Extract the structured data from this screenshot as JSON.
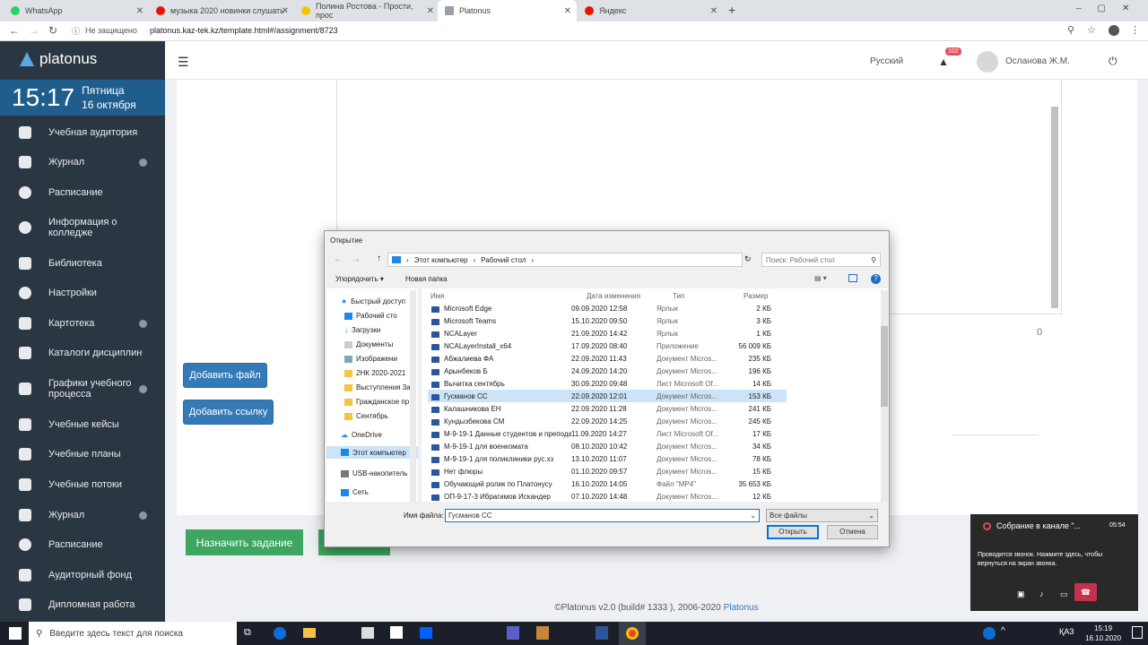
{
  "browser": {
    "tabs": [
      {
        "label": "WhatsApp",
        "color": "#25d366"
      },
      {
        "label": "музыка 2020 новинки слушать",
        "color": "#e61400"
      },
      {
        "label": "Полина Ростова - Прости, прос",
        "color": "#f5c400"
      },
      {
        "label": "Platonus",
        "color": "#9aa0a6"
      },
      {
        "label": "Яндекс",
        "color": "#e61400"
      }
    ],
    "security": "Не защищено",
    "url": "platonus.kaz-tek.kz/template.html#/assignment/8723"
  },
  "sidebar": {
    "logo": "platonus",
    "time": "15:17",
    "weekday": "Пятница",
    "date": "16 октября",
    "items": [
      "Учебная аудитория",
      "Журнал",
      "Расписание",
      "Информация о колледже",
      "Библиотека",
      "Настройки",
      "Картотека",
      "Каталоги дисциплин",
      "Графики учебного процесса",
      "Учебные кейсы",
      "Учебные планы",
      "Учебные потоки",
      "Журнал",
      "Расписание",
      "Аудиторный фонд",
      "Дипломная работа"
    ]
  },
  "header": {
    "language": "Русский",
    "notifications": "102",
    "user": "Осланова Ж.М."
  },
  "content": {
    "counter": "0",
    "add_file": "Добавить файл",
    "add_link": "Добавить ссылку",
    "assign": "Назначить задание"
  },
  "footer": {
    "text": "©Platonus v2.0 (build# 1333 ), 2006-2020 ",
    "link": "Platonus"
  },
  "dialog": {
    "title": "Открытие",
    "path": [
      "Этот компьютер",
      "Рабочий стол"
    ],
    "search_placeholder": "Поиск: Рабочий стол",
    "organize": "Упорядочить ▾",
    "new_folder": "Новая папка",
    "columns": {
      "name": "Имя",
      "date": "Дата изменения",
      "type": "Тип",
      "size": "Размер"
    },
    "tree": [
      "Быстрый доступ",
      "Рабочий сто",
      "Загрузки",
      "Документы",
      "Изображени",
      "2НК 2020-2021",
      "Выступления 3а",
      "Гражданское пр",
      "Сентябрь",
      "OneDrive",
      "Этот компьютер",
      "USB-накопитель",
      "Сеть"
    ],
    "files": [
      [
        "Microsoft Edge",
        "09.09.2020 12:58",
        "Ярлык",
        "2 КБ"
      ],
      [
        "Microsoft Teams",
        "15.10.2020 09:50",
        "Ярлык",
        "3 КБ"
      ],
      [
        "NCALayer",
        "21.09.2020 14:42",
        "Ярлык",
        "1 КБ"
      ],
      [
        "NCALayerInstall_x64",
        "17.09.2020 08:40",
        "Приложение",
        "56 009 КБ"
      ],
      [
        "Абжалиева ФА",
        "22.09.2020 11:43",
        "Документ Micros...",
        "235 КБ"
      ],
      [
        "Арынбеков Б",
        "24.09.2020 14:20",
        "Документ Micros...",
        "196 КБ"
      ],
      [
        "Вычитка сентябрь",
        "30.09.2020 09:48",
        "Лист Microsoft Of...",
        "14 КБ"
      ],
      [
        "Гусманов СС",
        "22.09.2020 12:01",
        "Документ Micros...",
        "153 КБ"
      ],
      [
        "Калашникова ЕН",
        "22.09.2020 11:28",
        "Документ Micros...",
        "241 КБ"
      ],
      [
        "Кундызбекова СМ",
        "22.09.2020 14:25",
        "Документ Micros...",
        "245 КБ"
      ],
      [
        "М-9-19-1 Данные студентов и препода...",
        "11.09.2020 14:27",
        "Лист Microsoft Of...",
        "17 КБ"
      ],
      [
        "М-9-19-1 для военкомата",
        "08.10.2020 10:42",
        "Документ Micros...",
        "34 КБ"
      ],
      [
        "М-9-19-1 для поликлиники рус.хз",
        "13.10.2020 11:07",
        "Документ Micros...",
        "78 КБ"
      ],
      [
        "Нет флюры",
        "01.10.2020 09:57",
        "Документ Micros...",
        "15 КБ"
      ],
      [
        "Обучающий ролик по Платонусу",
        "16.10.2020 14:05",
        "Файл \"MP4\"",
        "35 653 КБ"
      ],
      [
        "ОП-9-17-3 Ибрагимов Искандер",
        "07.10.2020 14:48",
        "Документ Micros...",
        "12 КБ"
      ]
    ],
    "filename_label": "Имя файла:",
    "filename": "Гусманов СС",
    "filter": "Все файлы",
    "open": "Открыть",
    "cancel": "Отмена"
  },
  "meeting": {
    "title": "Собрание в канале \"...",
    "time": "05:54",
    "text": "Проводится звонок. Нажмите здесь, чтобы вернуться на экран звонка."
  },
  "taskbar": {
    "search": "Введите здесь текст для поиска",
    "lang": "ҚАЗ",
    "time": "15:19",
    "date": "16.10.2020"
  }
}
